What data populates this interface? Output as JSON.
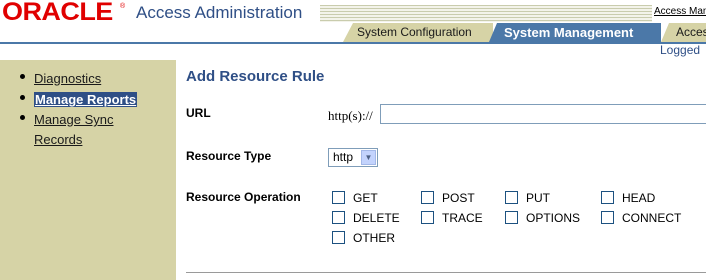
{
  "header": {
    "logo_text": "ORACLE",
    "app_title": "Access Administration",
    "top_link": "Access Manager",
    "tabs": [
      {
        "label": "System Configuration",
        "active": false
      },
      {
        "label": "System Management",
        "active": true
      },
      {
        "label": "Access"
      }
    ],
    "logged_in_text": "Logged"
  },
  "sidebar": {
    "items": [
      {
        "label": "Diagnostics",
        "active": false
      },
      {
        "label": "Manage Reports",
        "active": true
      },
      {
        "label": "Manage Sync",
        "active": false
      },
      {
        "label": "Records",
        "active": false
      }
    ]
  },
  "main": {
    "title": "Add Resource Rule",
    "url_label": "URL",
    "url_prefix": "http(s)://",
    "url_value": "",
    "resource_type_label": "Resource Type",
    "resource_type_value": "http",
    "resource_operation_label": "Resource Operation",
    "operations": [
      "GET",
      "POST",
      "PUT",
      "HEAD",
      "DELETE",
      "TRACE",
      "OPTIONS",
      "CONNECT",
      "OTHER"
    ]
  },
  "colors": {
    "brand_red": "#e00000",
    "accent_blue": "#2f4f86",
    "tab_blue": "#4b78a8",
    "sidebar_bg": "#d6d3a6"
  }
}
